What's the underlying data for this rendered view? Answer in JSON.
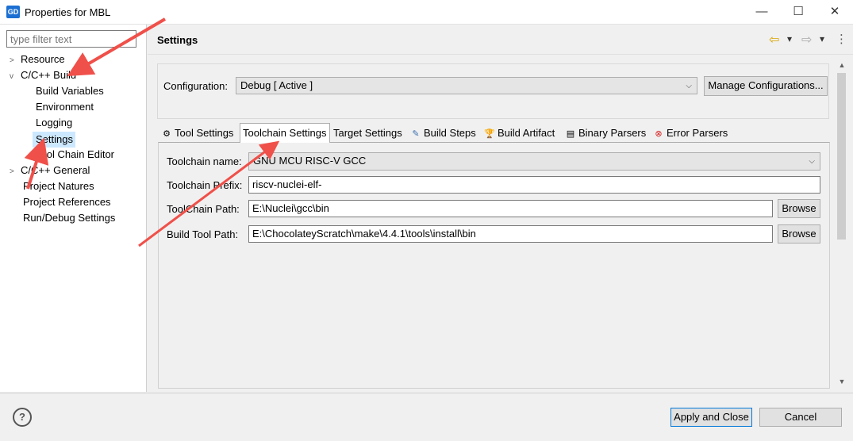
{
  "window": {
    "app_icon_text": "GD",
    "title": "Properties for MBL",
    "minimize": "—",
    "maximize": "☐",
    "close": "✕"
  },
  "left": {
    "filter_placeholder": "type filter text",
    "tree": [
      {
        "label": "Resource",
        "twisty": ">"
      },
      {
        "label": "C/C++ Build",
        "twisty": "v"
      },
      {
        "label": "Build Variables"
      },
      {
        "label": "Environment"
      },
      {
        "label": "Logging"
      },
      {
        "label": "Settings",
        "selected": true
      },
      {
        "label": "Tool Chain Editor"
      },
      {
        "label": "C/C++ General",
        "twisty": ">"
      },
      {
        "label": "Project Natures"
      },
      {
        "label": "Project References"
      },
      {
        "label": "Run/Debug Settings"
      }
    ]
  },
  "header": {
    "title": "Settings",
    "nav_back_icon": "⇦",
    "nav_fwd_icon": "⇨",
    "dropdown_icon": "▾",
    "menu_icon": "⋮"
  },
  "config": {
    "label": "Configuration:",
    "value": "Debug  [ Active ]",
    "manage_button": "Manage Configurations..."
  },
  "tabs": [
    {
      "label": "Tool Settings",
      "icon": "⚙"
    },
    {
      "label": "Toolchain Settings",
      "active": true
    },
    {
      "label": "Target Settings"
    },
    {
      "label": "Build Steps",
      "icon": "✎"
    },
    {
      "label": "Build Artifact",
      "icon": "🏆"
    },
    {
      "label": "Binary Parsers",
      "icon": "▤"
    },
    {
      "label": "Error Parsers",
      "icon": "⊗"
    }
  ],
  "fields": {
    "toolchain_name": {
      "label": "Toolchain name:",
      "value": "GNU MCU RISC-V GCC"
    },
    "toolchain_prefix": {
      "label": "Toolchain Prefix:",
      "value": "riscv-nuclei-elf-"
    },
    "toolchain_path": {
      "label": "ToolChain Path:",
      "value": "E:\\Nuclei\\gcc\\bin",
      "browse": "Browse"
    },
    "build_tool_path": {
      "label": "Build Tool Path:",
      "value": "E:\\ChocolateyScratch\\make\\4.4.1\\tools\\install\\bin",
      "browse": "Browse"
    }
  },
  "footer": {
    "help_icon": "?",
    "apply_close": "Apply and Close",
    "cancel": "Cancel"
  },
  "colors": {
    "annotation_arrow": "#f0504a",
    "selection": "#cce8ff"
  }
}
